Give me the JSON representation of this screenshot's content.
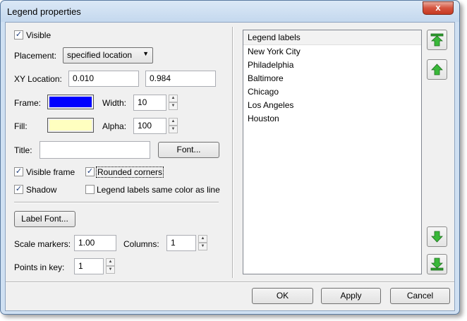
{
  "window": {
    "title": "Legend properties",
    "close_glyph": "x"
  },
  "general": {
    "visible_label": "Visible",
    "visible_checked": true,
    "placement_label": "Placement:",
    "placement_value": "specified location",
    "xy_label": "XY Location:",
    "x_value": "0.010",
    "y_value": "0.984"
  },
  "frame": {
    "label": "Frame:",
    "color": "#0000ff",
    "width_label": "Width:",
    "width_value": "10"
  },
  "fill": {
    "label": "Fill:",
    "color": "#ffffc0",
    "alpha_label": "Alpha:",
    "alpha_value": "100"
  },
  "title_row": {
    "label": "Title:",
    "value": "",
    "font_button": "Font..."
  },
  "options": {
    "visible_frame_label": "Visible frame",
    "visible_frame_checked": true,
    "rounded_corners_label": "Rounded corners",
    "rounded_corners_checked": true,
    "shadow_label": "Shadow",
    "shadow_checked": true,
    "same_color_label": "Legend labels same color as line",
    "same_color_checked": false
  },
  "label_font_button": "Label Font...",
  "scale": {
    "label": "Scale markers:",
    "value": "1.00",
    "columns_label": "Columns:",
    "columns_value": "1"
  },
  "points": {
    "label": "Points in key:",
    "value": "1"
  },
  "legend_list": {
    "header": "Legend labels",
    "items": [
      "New York City",
      "Philadelphia",
      "Baltimore",
      "Chicago",
      "Los Angeles",
      "Houston"
    ]
  },
  "footer": {
    "ok": "OK",
    "apply": "Apply",
    "cancel": "Cancel"
  },
  "icons": {
    "move_top": "move-top-icon",
    "move_up": "move-up-icon",
    "move_down": "move-down-icon",
    "move_bottom": "move-bottom-icon"
  }
}
